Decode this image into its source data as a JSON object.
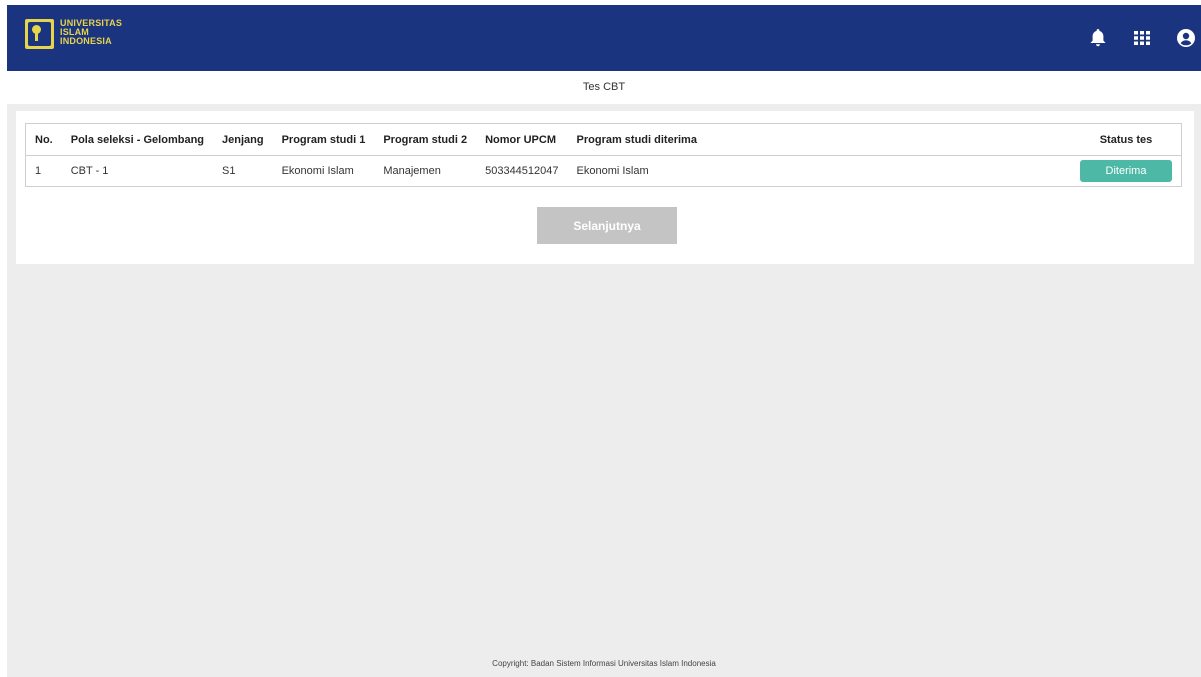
{
  "brand": {
    "line1": "UNIVERSITAS",
    "line2": "ISLAM",
    "line3": "INDONESIA",
    "colors": {
      "header": "#1b3480",
      "logo": "#e8d44a",
      "accent": "#4db8a5"
    }
  },
  "header_icons": [
    "bell-icon",
    "apps-grid-icon",
    "user-account-icon"
  ],
  "page": {
    "title": "Tes CBT"
  },
  "table": {
    "headers": {
      "no": "No.",
      "pola": "Pola seleksi - Gelombang",
      "jenjang": "Jenjang",
      "prodi1": "Program studi 1",
      "prodi2": "Program studi 2",
      "upcm": "Nomor UPCM",
      "diterima": "Program studi diterima",
      "status": "Status tes"
    },
    "rows": [
      {
        "no": "1",
        "pola": "CBT - 1",
        "jenjang": "S1",
        "prodi1": "Ekonomi Islam",
        "prodi2": "Manajemen",
        "upcm": "503344512047",
        "diterima": "Ekonomi Islam",
        "status": "Diterima"
      }
    ]
  },
  "actions": {
    "next_label": "Selanjutnya"
  },
  "footer": {
    "text": "Copyright: Badan Sistem Informasi Universitas Islam Indonesia"
  }
}
